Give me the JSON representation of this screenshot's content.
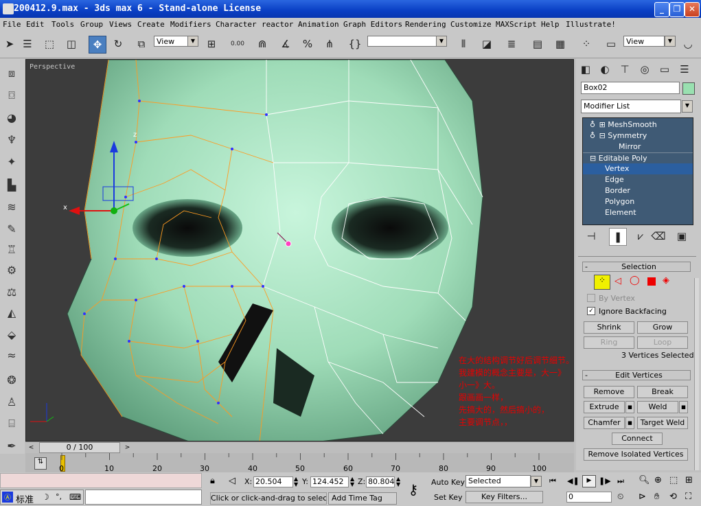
{
  "window": {
    "title": "200412.9.max - 3ds max 6 - Stand-alone License"
  },
  "menu": [
    "File",
    "Edit",
    "Tools",
    "Group",
    "Views",
    "Create",
    "Modifiers",
    "Character",
    "reactor",
    "Animation",
    "Graph Editors",
    "Rendering",
    "Customize",
    "MAXScript",
    "Help",
    "Illustrate!"
  ],
  "toolbar": {
    "ref_coord": "View",
    "ref_coord2": "View",
    "named_sel": ""
  },
  "viewport": {
    "label": "Perspective",
    "axis_x": "x",
    "axis_z": "z",
    "annotation_lines": [
      "在大的结构调节好后调节细节。",
      "我建模的概念主要是，大一》",
      "小一》大。",
      "跟画画一样，",
      "先搞大的，然后搞小的，",
      "主要调节点，，"
    ]
  },
  "command_panel": {
    "object_name": "Box02",
    "object_color": "#99e0b0",
    "modifier_list_label": "Modifier List",
    "stack": [
      {
        "label": "MeshSmooth",
        "indent": 0
      },
      {
        "label": "Symmetry",
        "indent": 0
      },
      {
        "label": "Mirror",
        "indent": 1
      },
      {
        "label": "Editable Poly",
        "indent": 0
      },
      {
        "label": "Vertex",
        "indent": 1
      },
      {
        "label": "Edge",
        "indent": 1
      },
      {
        "label": "Border",
        "indent": 1
      },
      {
        "label": "Polygon",
        "indent": 1
      },
      {
        "label": "Element",
        "indent": 1
      }
    ],
    "selection": {
      "title": "Selection",
      "by_vertex": "By Vertex",
      "ignore_backfacing": "Ignore Backfacing",
      "shrink": "Shrink",
      "grow": "Grow",
      "ring": "Ring",
      "loop": "Loop",
      "status": "3 Vertices Selected"
    },
    "edit_vertices": {
      "title": "Edit Vertices",
      "remove": "Remove",
      "break": "Break",
      "extrude": "Extrude",
      "weld": "Weld",
      "chamfer": "Chamfer",
      "target_weld": "Target Weld",
      "connect": "Connect",
      "remove_isolated": "Remove Isolated Vertices"
    }
  },
  "timeline": {
    "frame_counter": "0 / 100",
    "ticks": [
      "0",
      "10",
      "20",
      "30",
      "40",
      "50",
      "60",
      "70",
      "80",
      "90",
      "100"
    ]
  },
  "status": {
    "x_label": "X:",
    "x": "20.504",
    "y_label": "Y:",
    "y": "124.452",
    "z_label": "Z:",
    "z": "80.804",
    "prompt": "Click or click-and-drag to select obj",
    "add_time_tag": "Add Time Tag",
    "auto_key": "Auto Key",
    "set_key": "Set Key",
    "key_mode": "Selected",
    "key_filters": "Key Filters...",
    "current_frame": "0",
    "ime_label": "标准"
  }
}
